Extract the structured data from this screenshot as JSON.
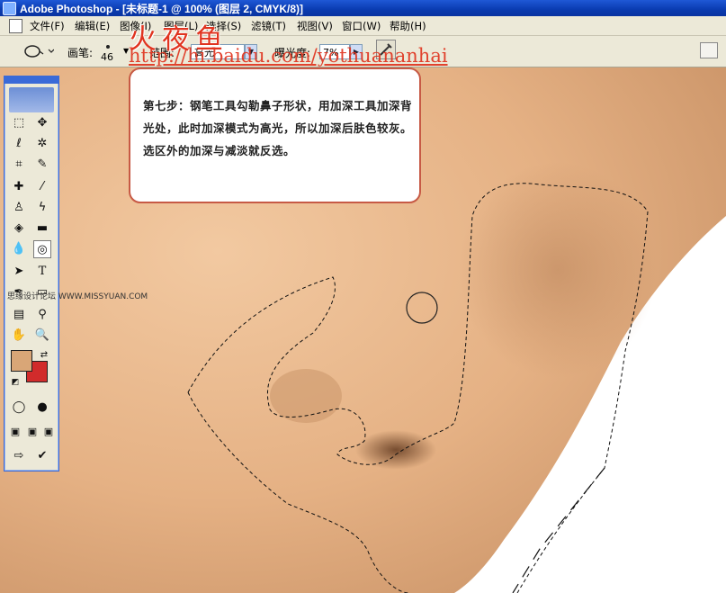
{
  "window": {
    "title": "Adobe Photoshop - [未标题-1 @ 100% (图层 2, CMYK/8)]"
  },
  "menu": [
    "文件(F)",
    "编辑(E)",
    "图像(I)",
    "图层(L)",
    "选择(S)",
    "滤镜(T)",
    "视图(V)",
    "窗口(W)",
    "帮助(H)"
  ],
  "options": {
    "brush_label": "画笔:",
    "brush_size": "46",
    "range_label": "范围:",
    "range_value": "高光",
    "exposure_label": "曝光度:",
    "exposure_value": "7%"
  },
  "tutorial": {
    "text": "第七步：钢笔工具勾勒鼻子形状，用加深工具加深背光处，此时加深模式为高光，所以加深后肤色较灰。选区外的加深与减淡就反选。"
  },
  "watermark": {
    "name": "火夜鱼",
    "url": "http://hi.baidu.com/yothuananhai",
    "site": "思缘设计论坛 WWW.MISSYUAN.COM"
  },
  "colors": {
    "foreground": "#d9a677",
    "background": "#d12b2b",
    "accent": "#c75a45"
  },
  "icons": {
    "tools": [
      "marquee",
      "move",
      "lasso",
      "magic-wand",
      "crop",
      "slice",
      "healing-brush",
      "brush",
      "clone-stamp",
      "history-brush",
      "eraser",
      "gradient",
      "blur",
      "burn",
      "path-select",
      "type",
      "pen",
      "shape",
      "notes",
      "eyedropper",
      "hand",
      "zoom"
    ]
  }
}
